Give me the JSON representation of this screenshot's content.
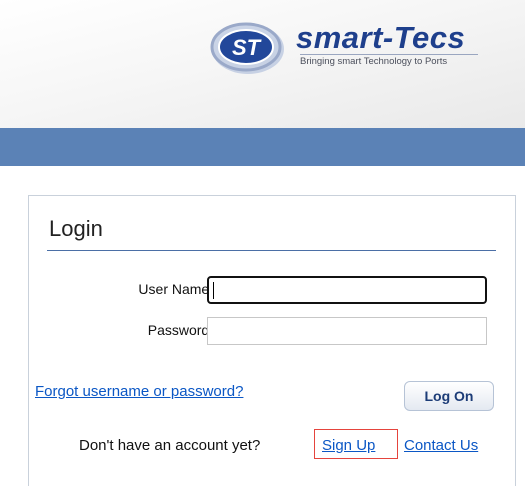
{
  "header": {
    "brand": "smart-Tecs",
    "logo_initials": "ST",
    "tagline": "Bringing smart Technology to Ports",
    "band_color": "#5b82b6",
    "brand_color": "#1e3f8c"
  },
  "login": {
    "title": "Login",
    "username_label": "User Name :",
    "username_value": "",
    "password_label": "Password :",
    "password_value": "",
    "forgot_link": "Forgot username or password?",
    "logon_button": "Log On",
    "no_account_text": "Don't have an account yet?",
    "signup_link": "Sign Up",
    "contact_link": "Contact Us",
    "link_color": "#0b57c5",
    "highlight_color": "#e5443d"
  }
}
